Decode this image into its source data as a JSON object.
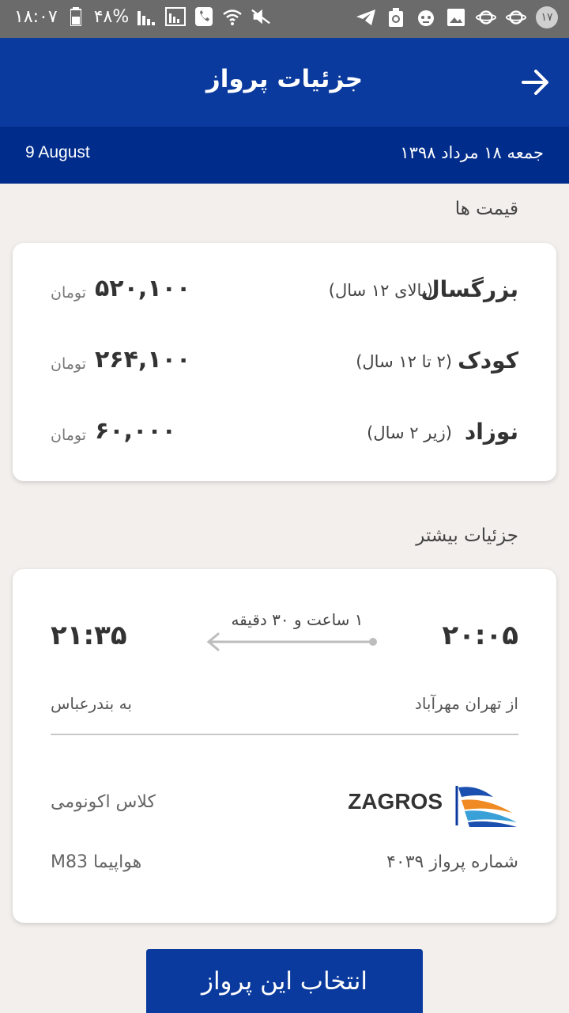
{
  "status_bar": {
    "time": "۱۸:۰۷",
    "battery": "۴۸%",
    "notification_count": "۱۷",
    "icons_left": [
      "battery-icon",
      "signal-icon",
      "signal-box-icon",
      "phone-icon",
      "wifi-icon",
      "mute-icon"
    ],
    "icons_right": [
      "telegram-icon",
      "recycle-icon",
      "robot-icon",
      "image-icon",
      "planet-icon",
      "planet-icon"
    ]
  },
  "header": {
    "title": "جزئیات پرواز"
  },
  "date_bar": {
    "gregorian": "9 August",
    "persian": "جمعه ۱۸ مرداد ۱۳۹۸"
  },
  "prices": {
    "section_title": "قیمت ها",
    "rows": [
      {
        "name": "بزرگسال",
        "age": "(بالای ۱۲ سال)",
        "amount": "۵۲۰,۱۰۰",
        "currency": "تومان"
      },
      {
        "name": "کودک",
        "age": "(۲ تا ۱۲ سال)",
        "amount": "۲۶۴,۱۰۰",
        "currency": "تومان"
      },
      {
        "name": "نوزاد",
        "age": "(زیر ۲ سال)",
        "amount": "۶۰,۰۰۰",
        "currency": "تومان"
      }
    ]
  },
  "details": {
    "section_title": "جزئیات بیشتر",
    "departure_time": "۲۰:۰۵",
    "arrival_time": "۲۱:۳۵",
    "duration": "۱ ساعت و ۳۰ دقیقه",
    "from": "از تهران مهرآباد",
    "to": "به بندرعباس",
    "airline": "ZAGROS",
    "class": "کلاس اکونومی",
    "flight_number": "شماره پرواز ۴۰۳۹",
    "aircraft": "هواپیما M83"
  },
  "action": {
    "select_label": "انتخاب این پرواز"
  },
  "colors": {
    "primary": "#0a3a9d",
    "primary_dark": "#002d8b",
    "background": "#f2efec"
  }
}
